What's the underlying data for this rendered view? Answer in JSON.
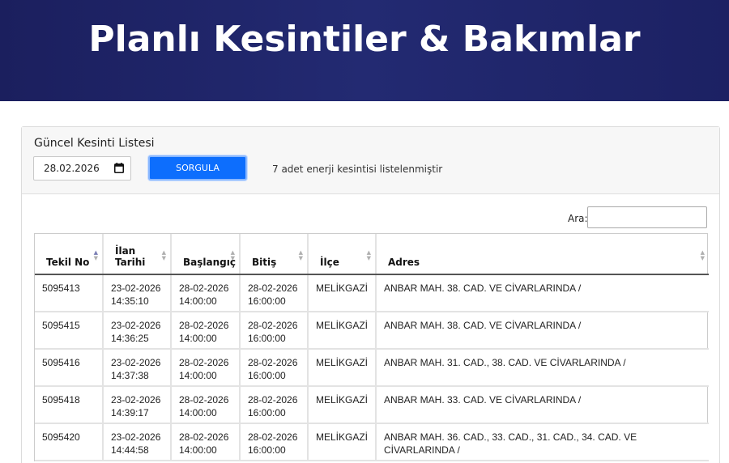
{
  "header": {
    "title": "Planlı Kesintiler & Bakımlar"
  },
  "panel": {
    "title": "Güncel Kesinti Listesi",
    "date_value": "28.02.2026",
    "query_button": "SORGULA",
    "result_text": "7 adet enerji kesintisi listelenmiştir"
  },
  "search": {
    "label": "Ara:",
    "value": ""
  },
  "table": {
    "columns": [
      "Tekil No",
      "İlan Tarihi",
      "Başlangıç",
      "Bitiş",
      "İlçe",
      "Adres"
    ],
    "column_lines": [
      [
        "Tekil No"
      ],
      [
        "İlan",
        "Tarihi"
      ],
      [
        "Başlangıç"
      ],
      [
        "Bitiş"
      ],
      [
        "İlçe"
      ],
      [
        "Adres"
      ]
    ],
    "sorted_column": "Tekil No",
    "rows": [
      {
        "tekil_no": "5095413",
        "ilan_date": "23-02-2026",
        "ilan_time": "14:35:10",
        "start_date": "28-02-2026",
        "start_time": "14:00:00",
        "end_date": "28-02-2026",
        "end_time": "16:00:00",
        "ilce": "MELİKGAZİ",
        "adres": "ANBAR MAH. 38. CAD. VE CİVARLARINDA /"
      },
      {
        "tekil_no": "5095415",
        "ilan_date": "23-02-2026",
        "ilan_time": "14:36:25",
        "start_date": "28-02-2026",
        "start_time": "14:00:00",
        "end_date": "28-02-2026",
        "end_time": "16:00:00",
        "ilce": "MELİKGAZİ",
        "adres": "ANBAR MAH. 38. CAD. VE CİVARLARINDA /"
      },
      {
        "tekil_no": "5095416",
        "ilan_date": "23-02-2026",
        "ilan_time": "14:37:38",
        "start_date": "28-02-2026",
        "start_time": "14:00:00",
        "end_date": "28-02-2026",
        "end_time": "16:00:00",
        "ilce": "MELİKGAZİ",
        "adres": "ANBAR MAH. 31. CAD., 38. CAD. VE CİVARLARINDA /"
      },
      {
        "tekil_no": "5095418",
        "ilan_date": "23-02-2026",
        "ilan_time": "14:39:17",
        "start_date": "28-02-2026",
        "start_time": "14:00:00",
        "end_date": "28-02-2026",
        "end_time": "16:00:00",
        "ilce": "MELİKGAZİ",
        "adres": "ANBAR MAH. 33. CAD. VE CİVARLARINDA /"
      },
      {
        "tekil_no": "5095420",
        "ilan_date": "23-02-2026",
        "ilan_time": "14:44:58",
        "start_date": "28-02-2026",
        "start_time": "14:00:00",
        "end_date": "28-02-2026",
        "end_time": "16:00:00",
        "ilce": "MELİKGAZİ",
        "adres": "ANBAR MAH. 36. CAD., 33. CAD., 31. CAD., 34. CAD. VE CİVARLARINDA /"
      }
    ]
  },
  "colors": {
    "header_bg": "#1f2468",
    "button": "#0d6efd",
    "sort_active": "#7b7fb5"
  }
}
